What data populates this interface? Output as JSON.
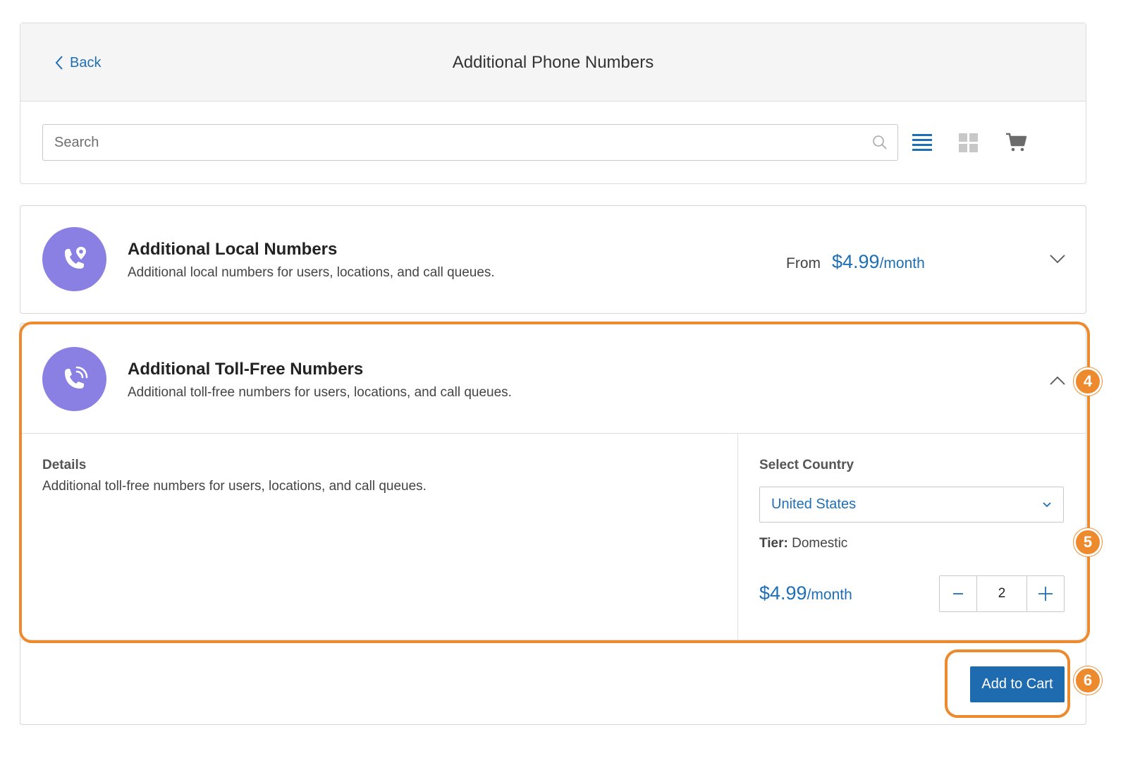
{
  "header": {
    "back_label": "Back",
    "title": "Additional Phone Numbers"
  },
  "search": {
    "placeholder": "Search",
    "value": ""
  },
  "toolbar_icons": [
    "list-view-icon",
    "grid-view-icon",
    "cart-icon"
  ],
  "products": [
    {
      "title": "Additional Local Numbers",
      "description": "Additional local numbers for users, locations, and call queues.",
      "price_prefix": "From",
      "price_amount": "$4.99",
      "price_unit": "/month",
      "icon": "phone-location-icon",
      "expanded": false
    },
    {
      "title": "Additional Toll-Free Numbers",
      "description": "Additional toll-free numbers for users, locations, and call queues.",
      "icon": "phone-ringing-icon",
      "expanded": true,
      "details_title": "Details",
      "details_text": "Additional toll-free numbers for users, locations, and call queues.",
      "country_label": "Select Country",
      "country_value": "United States",
      "tier_label": "Tier:",
      "tier_value": "Domestic",
      "price_amount": "$4.99",
      "price_unit": "/month",
      "quantity": "2",
      "add_button": "Add to Cart"
    }
  ],
  "annotations": [
    "4",
    "5",
    "6"
  ],
  "colors": {
    "accent": "#1f6fb5",
    "button": "#1f6bb0",
    "avatar": "#8a7fe3",
    "highlight": "#ee8a2e"
  }
}
